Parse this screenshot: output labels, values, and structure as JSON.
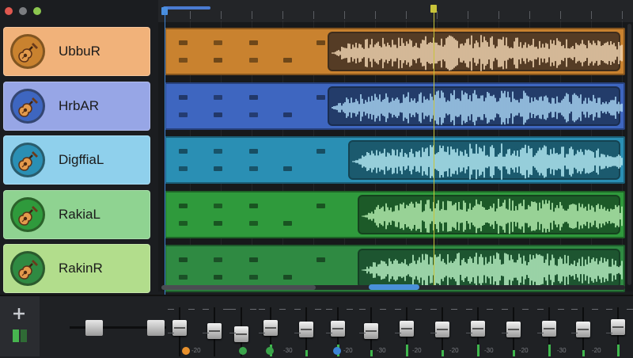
{
  "tracks": [
    {
      "name": "UbbuR",
      "header_color": "#f1b27a",
      "lane_color": "#c9822f",
      "wave_bg": "#553c25",
      "wave_color": "#f3d7b4",
      "wave_start": 0.35
    },
    {
      "name": "HrbAR",
      "header_color": "#97a6e6",
      "lane_color": "#3e66c0",
      "wave_bg": "#233c6a",
      "wave_color": "#a9d6f3",
      "wave_start": 0.35
    },
    {
      "name": "DigffiaL",
      "header_color": "#8fd0ec",
      "lane_color": "#2a8fb4",
      "wave_bg": "#1b5a6e",
      "wave_color": "#b5ecf5",
      "wave_start": 0.395
    },
    {
      "name": "RakiaL",
      "header_color": "#8fd391",
      "lane_color": "#2f9a3c",
      "wave_bg": "#1c5a28",
      "wave_color": "#b7f0b2",
      "wave_start": 0.415
    },
    {
      "name": "RakinR",
      "header_color": "#b2dd8c",
      "lane_color": "#2f8a42",
      "wave_bg": "#1d5530",
      "wave_color": "#b9f2c4",
      "wave_start": 0.415
    }
  ],
  "mixer": {
    "scale_labels": [
      "-20",
      "-30",
      "-20",
      "-30",
      "-20",
      "-20",
      "-30",
      "-20",
      "-30",
      "-20"
    ]
  }
}
